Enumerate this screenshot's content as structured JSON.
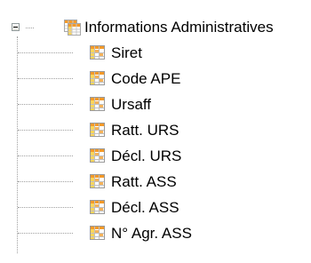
{
  "tree": {
    "root": {
      "label": "Informations Administratives",
      "expanded": true,
      "icon": "table-folder-icon"
    },
    "children": [
      {
        "label": "Siret",
        "icon": "table-icon"
      },
      {
        "label": "Code APE",
        "icon": "table-icon"
      },
      {
        "label": "Ursaff",
        "icon": "table-icon"
      },
      {
        "label": "Ratt. URS",
        "icon": "table-icon"
      },
      {
        "label": "Décl. URS",
        "icon": "table-icon"
      },
      {
        "label": "Ratt. ASS",
        "icon": "table-icon"
      },
      {
        "label": "Décl. ASS",
        "icon": "table-icon"
      },
      {
        "label": "N° Agr. ASS",
        "icon": "table-icon"
      }
    ],
    "colors": {
      "icon_orange": "#f39a2a",
      "icon_yellow": "#ffd55a",
      "connector": "#a0a0a0"
    }
  }
}
